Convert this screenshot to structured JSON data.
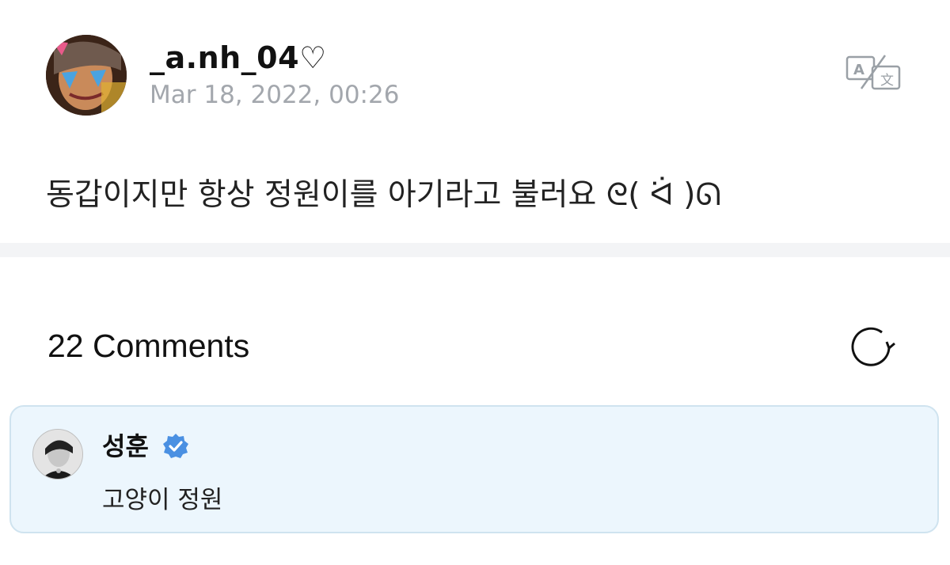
{
  "post": {
    "author": {
      "username": "_a.nh_04",
      "heart": "♡"
    },
    "timestamp": "Mar 18, 2022, 00:26",
    "body": "동갑이지만 항상 정원이를 아기라고 불러요 ᘓ( ᐛ )ᘏ",
    "translate_icon": "translate-icon"
  },
  "comments": {
    "count_label": "22 Comments",
    "refresh_icon": "refresh-icon",
    "items": [
      {
        "author": "성훈",
        "verified": true,
        "verified_color": "#4a90e2",
        "text": "고양이 정원"
      }
    ]
  },
  "colors": {
    "divider": "#f3f4f6",
    "comment_bg": "#ecf6fd",
    "comment_border": "#cfe3ef",
    "timestamp": "#a3a7ad"
  }
}
